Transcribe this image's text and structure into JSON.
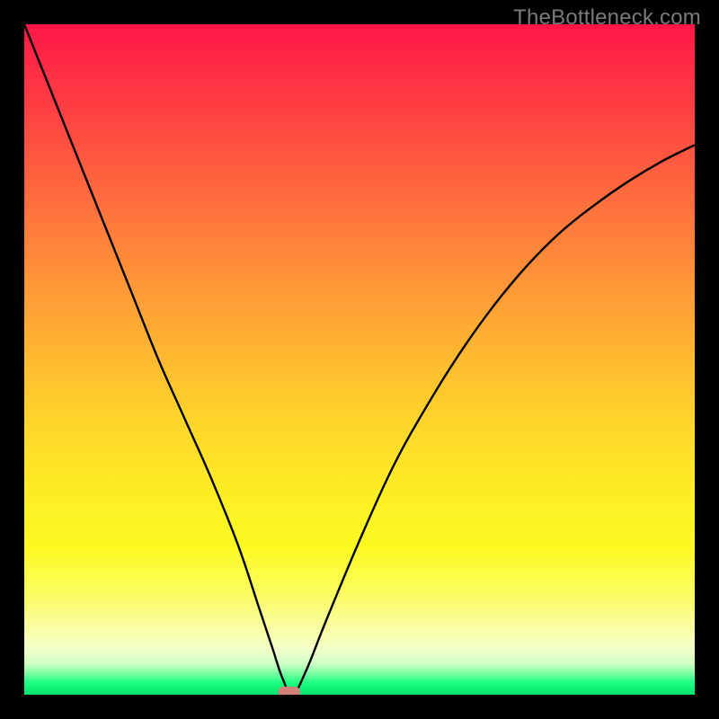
{
  "watermark": "TheBottleneck.com",
  "chart_data": {
    "type": "line",
    "title": "",
    "xlabel": "",
    "ylabel": "",
    "xlim": [
      0,
      100
    ],
    "ylim": [
      0,
      100
    ],
    "grid": false,
    "legend": false,
    "background_gradient": {
      "top": "#ff1647",
      "middle": "#fdee24",
      "bottom": "#00e36e"
    },
    "series": [
      {
        "name": "bottleneck-curve",
        "color": "#000000",
        "x": [
          0,
          4,
          8,
          12,
          16,
          20,
          24,
          28,
          32,
          35,
          37,
          38.5,
          40,
          42,
          45,
          50,
          55,
          60,
          65,
          70,
          75,
          80,
          85,
          90,
          95,
          100
        ],
        "y": [
          100,
          90,
          80,
          70,
          60,
          50,
          41,
          32,
          22,
          13,
          7,
          2.5,
          0,
          3.5,
          11,
          23,
          34,
          43,
          51,
          58,
          64,
          69,
          73,
          76.5,
          79.5,
          82
        ]
      }
    ],
    "annotations": [
      {
        "name": "optimal-marker",
        "shape": "rounded-rect",
        "x": 39.5,
        "y": 0,
        "color": "#d48078"
      }
    ]
  }
}
